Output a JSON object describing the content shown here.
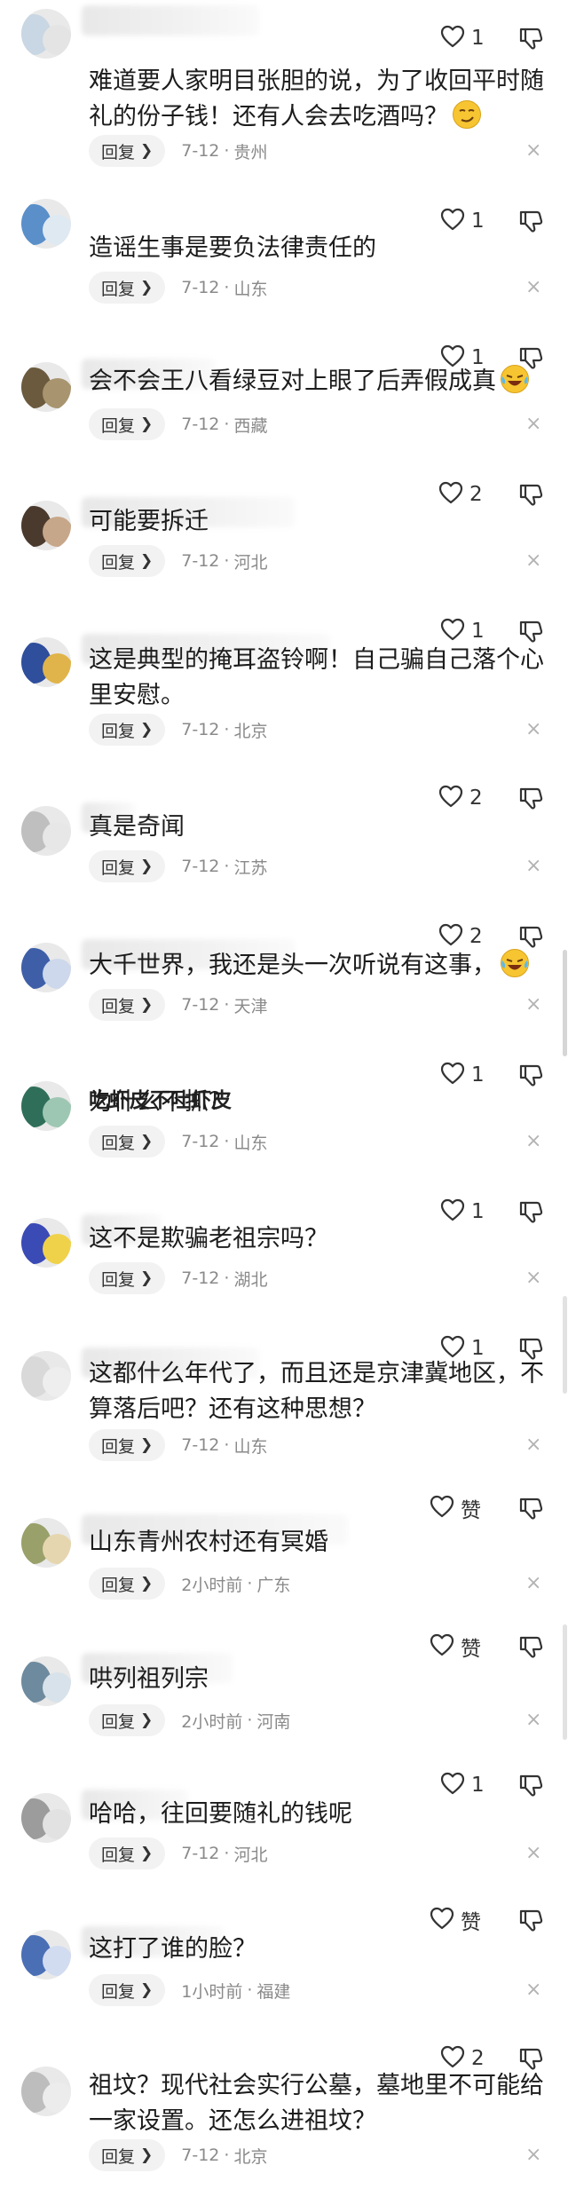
{
  "comments": [
    {
      "user": "",
      "likes": "1",
      "text": "难道要人家明目张胆的说，为了收回平时随礼的份子钱！还有人会去吃酒吗？",
      "emoji": "smirk",
      "reply": "回复",
      "date": "7-12",
      "location": "贵州"
    },
    {
      "user": "",
      "likes": "1",
      "text": "造谣生事是要负法律责任的",
      "emoji": "",
      "reply": "回复",
      "date": "7-12",
      "location": "山东"
    },
    {
      "user": "",
      "likes": "1",
      "text": "会不会王八看绿豆对上眼了后弄假成真",
      "emoji": "laugh-cry",
      "reply": "回复",
      "date": "7-12",
      "location": "西藏"
    },
    {
      "user": "",
      "likes": "2",
      "text": "可能要拆迁",
      "emoji": "",
      "reply": "回复",
      "date": "7-12",
      "location": "河北"
    },
    {
      "user": "",
      "likes": "1",
      "text": "这是典型的掩耳盗铃啊！自己骗自己落个心里安慰。",
      "emoji": "",
      "reply": "回复",
      "date": "7-12",
      "location": "北京"
    },
    {
      "user": "",
      "likes": "2",
      "text": "真是奇闻",
      "emoji": "",
      "reply": "回复",
      "date": "7-12",
      "location": "江苏"
    },
    {
      "user": "",
      "likes": "2",
      "text": "大千世界，我还是头一次听说有这事，",
      "emoji": "laugh-cry",
      "reply": "回复",
      "date": "7-12",
      "location": "天津"
    },
    {
      "user": "吃虾皮不吐虾皮",
      "likes": "1",
      "text": "为什么不抓？",
      "emoji": "",
      "reply": "回复",
      "date": "7-12",
      "location": "山东"
    },
    {
      "user": "",
      "likes": "1",
      "text": "这不是欺骗老祖宗吗？",
      "emoji": "",
      "reply": "回复",
      "date": "7-12",
      "location": "湖北"
    },
    {
      "user": "",
      "likes": "1",
      "text": "这都什么年代了，而且还是京津冀地区，不算落后吧？还有这种思想？",
      "emoji": "",
      "reply": "回复",
      "date": "7-12",
      "location": "山东"
    },
    {
      "user": "",
      "likes": "赞",
      "text": "山东青州农村还有冥婚",
      "emoji": "",
      "reply": "回复",
      "date": "2小时前",
      "location": "广东"
    },
    {
      "user": "",
      "likes": "赞",
      "text": "哄列祖列宗",
      "emoji": "",
      "reply": "回复",
      "date": "2小时前",
      "location": "河南"
    },
    {
      "user": "",
      "likes": "1",
      "text": "哈哈，往回要随礼的钱呢",
      "emoji": "",
      "reply": "回复",
      "date": "7-12",
      "location": "河北"
    },
    {
      "user": "",
      "likes": "赞",
      "text": "这打了谁的脸？",
      "emoji": "",
      "reply": "回复",
      "date": "1小时前",
      "location": "福建"
    },
    {
      "user": "",
      "likes": "2",
      "text": "祖坟？现代社会实行公墓，墓地里不可能给一家设置。还怎么进祖坟？",
      "emoji": "",
      "reply": "回复",
      "date": "7-12",
      "location": "北京"
    }
  ],
  "colors": {
    "text": "#1c1c1c",
    "meta": "#8a8a8a",
    "reply_bg": "#f2f2f2",
    "icon": "#333333",
    "close": "#b3b3b3"
  },
  "icons": {
    "like": "heart-outline-icon",
    "dislike": "thumbs-down-outline-icon",
    "dismiss": "close-icon",
    "reply": "chevron-right-icon"
  }
}
